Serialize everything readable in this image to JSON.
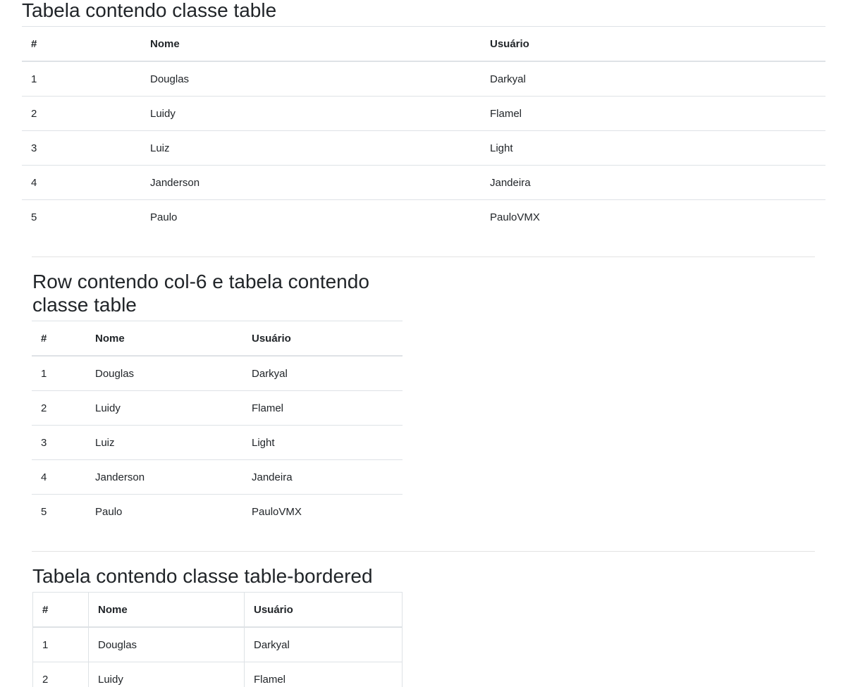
{
  "sections": [
    {
      "title": "Tabela contendo classe table",
      "headers": [
        "#",
        "Nome",
        "Usuário"
      ],
      "rows": [
        [
          "1",
          "Douglas",
          "Darkyal"
        ],
        [
          "2",
          "Luidy",
          "Flamel"
        ],
        [
          "3",
          "Luiz",
          "Light"
        ],
        [
          "4",
          "Janderson",
          "Jandeira"
        ],
        [
          "5",
          "Paulo",
          "PauloVMX"
        ]
      ]
    },
    {
      "title": "Row contendo col-6 e tabela contendo classe table",
      "headers": [
        "#",
        "Nome",
        "Usuário"
      ],
      "rows": [
        [
          "1",
          "Douglas",
          "Darkyal"
        ],
        [
          "2",
          "Luidy",
          "Flamel"
        ],
        [
          "3",
          "Luiz",
          "Light"
        ],
        [
          "4",
          "Janderson",
          "Jandeira"
        ],
        [
          "5",
          "Paulo",
          "PauloVMX"
        ]
      ]
    },
    {
      "title": "Tabela contendo classe table-bordered",
      "headers": [
        "#",
        "Nome",
        "Usuário"
      ],
      "rows": [
        [
          "1",
          "Douglas",
          "Darkyal"
        ],
        [
          "2",
          "Luidy",
          "Flamel"
        ]
      ]
    }
  ]
}
